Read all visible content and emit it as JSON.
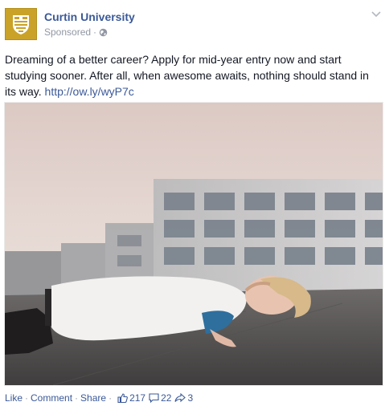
{
  "post": {
    "page_name": "Curtin University",
    "sponsored_label": "Sponsored",
    "separator": "·",
    "text_body": "Dreaming of a better career? Apply for mid-year entry now and start studying sooner. After all, when awesome awaits, nothing should stand in its way.",
    "link_text": "http://ow.ly/wyP7c"
  },
  "actions": {
    "like_label": "Like",
    "comment_label": "Comment",
    "share_label": "Share",
    "sep": "·",
    "like_count": "217",
    "comment_count": "22",
    "share_count": "3"
  },
  "colors": {
    "link": "#3b5998",
    "meta": "#9197a3",
    "logo_gold": "#c9a227"
  },
  "icons": {
    "logo": "curtin-shield-logo-icon",
    "audience": "globe-icon",
    "menu": "chevron-down-icon",
    "likes": "thumbs-up-icon",
    "comments": "comment-bubble-icon",
    "shares": "share-arrow-icon"
  }
}
